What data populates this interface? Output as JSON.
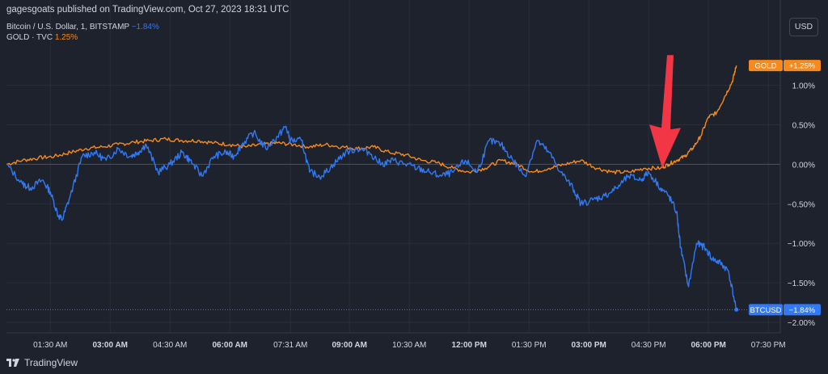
{
  "header": {
    "publish_text": "gagesgoats published on TradingView.com, Oct 27, 2023 18:31 UTC",
    "series": [
      {
        "label": "Bitcoin / U.S. Dollar, 1, BITSTAMP",
        "value": "−1.84%"
      },
      {
        "label": "GOLD · TVC",
        "value": "1.25%"
      }
    ],
    "currency_button": "USD"
  },
  "footer": {
    "brand": "TradingView"
  },
  "colors": {
    "background": "#1e222d",
    "btc": "#3179f5",
    "gold": "#f68a1e",
    "arrow": "#f23645",
    "grid": "#2a2e39"
  },
  "chart_data": {
    "type": "line",
    "title": "",
    "x_tick_labels": [
      {
        "label": "01:30 AM",
        "bold": false
      },
      {
        "label": "03:00 AM",
        "bold": true
      },
      {
        "label": "04:30 AM",
        "bold": false
      },
      {
        "label": "06:00 AM",
        "bold": true
      },
      {
        "label": "07:31 AM",
        "bold": false
      },
      {
        "label": "09:00 AM",
        "bold": true
      },
      {
        "label": "10:30 AM",
        "bold": false
      },
      {
        "label": "12:00 PM",
        "bold": true
      },
      {
        "label": "01:30 PM",
        "bold": false
      },
      {
        "label": "03:00 PM",
        "bold": true
      },
      {
        "label": "04:30 PM",
        "bold": false
      },
      {
        "label": "06:00 PM",
        "bold": true
      },
      {
        "label": "07:30 PM",
        "bold": false
      }
    ],
    "x_tick_hours": [
      1.5,
      3.0,
      4.5,
      6.0,
      7.52,
      9.0,
      10.5,
      12.0,
      13.5,
      15.0,
      16.5,
      18.0,
      19.5
    ],
    "y_ticks": [
      1.0,
      0.5,
      0.0,
      -0.5,
      -1.0,
      -1.5,
      -2.0
    ],
    "y_tick_labels": [
      "1.00%",
      "0.50%",
      "0.00%",
      "−0.50%",
      "−1.00%",
      "−1.50%",
      "−2.00%"
    ],
    "ylim": [
      -2.1,
      1.25
    ],
    "xlim_hours": [
      0.4,
      19.8
    ],
    "y_unit": "%",
    "x_unit": "time (UTC)",
    "grid": true,
    "series": [
      {
        "name": "BTCUSD",
        "label": "BTCUSD",
        "last_label": "−1.84%",
        "x_hours": [
          0.4,
          0.8,
          1.0,
          1.3,
          1.5,
          1.7,
          1.8,
          2.0,
          2.3,
          2.6,
          2.9,
          3.2,
          3.5,
          3.7,
          3.9,
          4.2,
          4.5,
          4.8,
          5.0,
          5.3,
          5.6,
          5.9,
          6.1,
          6.3,
          6.6,
          6.9,
          7.2,
          7.4,
          7.52,
          7.8,
          8.0,
          8.3,
          8.6,
          8.9,
          9.2,
          9.5,
          9.8,
          10.1,
          10.4,
          10.7,
          11.0,
          11.3,
          11.6,
          11.9,
          12.2,
          12.5,
          12.8,
          13.1,
          13.4,
          13.7,
          14.0,
          14.3,
          14.6,
          14.8,
          15.1,
          15.4,
          15.7,
          16.0,
          16.3,
          16.5,
          16.8,
          17.0,
          17.2,
          17.3,
          17.5,
          17.7,
          17.9,
          18.1,
          18.3,
          18.5,
          18.7
        ],
        "values": [
          0.0,
          -0.25,
          -0.3,
          -0.2,
          -0.35,
          -0.65,
          -0.7,
          -0.4,
          0.1,
          0.15,
          0.05,
          0.2,
          0.1,
          0.15,
          0.25,
          -0.1,
          0.0,
          0.15,
          0.05,
          -0.15,
          0.1,
          0.15,
          0.1,
          0.25,
          0.4,
          0.2,
          0.35,
          0.48,
          0.3,
          0.3,
          -0.1,
          -0.15,
          0.0,
          0.15,
          0.2,
          0.15,
          0.0,
          0.05,
          0.0,
          -0.05,
          -0.1,
          -0.15,
          -0.1,
          0.05,
          -0.1,
          0.3,
          0.25,
          0.05,
          -0.15,
          0.3,
          0.15,
          -0.1,
          -0.3,
          -0.5,
          -0.45,
          -0.4,
          -0.3,
          -0.15,
          -0.2,
          -0.1,
          -0.3,
          -0.4,
          -0.6,
          -1.05,
          -1.55,
          -1.0,
          -1.05,
          -1.2,
          -1.25,
          -1.35,
          -1.84
        ]
      },
      {
        "name": "GOLD",
        "label": "GOLD",
        "last_label": "+1.25%",
        "x_hours": [
          0.4,
          0.8,
          1.2,
          1.6,
          2.0,
          2.4,
          2.8,
          3.2,
          3.6,
          4.0,
          4.4,
          4.8,
          5.2,
          5.6,
          6.0,
          6.4,
          6.8,
          7.2,
          7.6,
          8.0,
          8.4,
          8.8,
          9.2,
          9.6,
          10.0,
          10.4,
          10.8,
          11.2,
          11.6,
          12.0,
          12.4,
          12.8,
          13.2,
          13.6,
          14.0,
          14.4,
          14.8,
          15.2,
          15.6,
          16.0,
          16.4,
          16.8,
          17.0,
          17.2,
          17.4,
          17.6,
          17.8,
          18.0,
          18.2,
          18.4,
          18.6,
          18.7
        ],
        "values": [
          0.0,
          0.05,
          0.08,
          0.1,
          0.15,
          0.2,
          0.22,
          0.25,
          0.28,
          0.3,
          0.32,
          0.3,
          0.3,
          0.27,
          0.25,
          0.22,
          0.25,
          0.27,
          0.25,
          0.22,
          0.25,
          0.22,
          0.2,
          0.22,
          0.15,
          0.12,
          0.05,
          0.02,
          -0.05,
          -0.1,
          -0.05,
          0.05,
          0.0,
          -0.1,
          -0.05,
          0.0,
          0.05,
          -0.05,
          -0.1,
          -0.1,
          -0.05,
          -0.05,
          0.0,
          0.05,
          0.1,
          0.2,
          0.35,
          0.6,
          0.65,
          0.85,
          1.05,
          1.25
        ]
      }
    ],
    "annotation": {
      "type": "arrow",
      "at_hour": 16.8,
      "at_value": -0.05,
      "color": "#f23645"
    }
  }
}
